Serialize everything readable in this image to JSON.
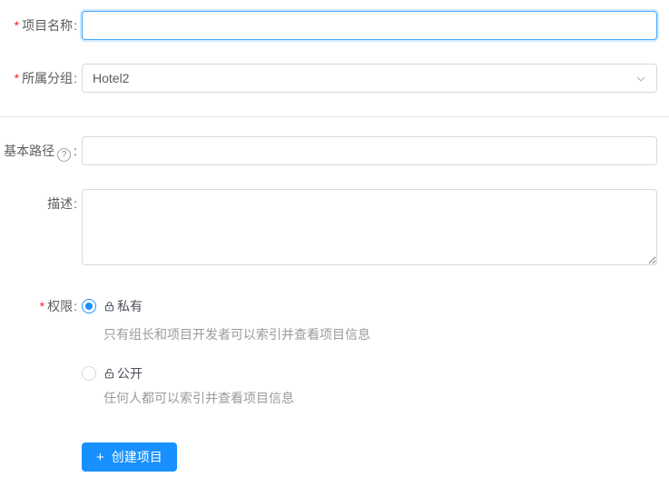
{
  "form": {
    "required_mark": "*",
    "colon": ":",
    "fields": {
      "project_name": {
        "label": "项目名称",
        "required": true,
        "value": "",
        "focused": true
      },
      "group": {
        "label": "所属分组",
        "required": true,
        "value": "Hotel2"
      },
      "base_path": {
        "label": "基本路径",
        "value": "",
        "help_glyph": "?"
      },
      "description": {
        "label": "描述",
        "value": ""
      },
      "permission": {
        "label": "权限",
        "required": true,
        "options": [
          {
            "label": "私有",
            "icon": "lock-closed-icon",
            "selected": true,
            "description": "只有组长和项目开发者可以索引并查看项目信息"
          },
          {
            "label": "公开",
            "icon": "lock-open-icon",
            "selected": false,
            "description": "任何人都可以索引并查看项目信息"
          }
        ]
      }
    },
    "submit": {
      "plus_glyph": "+",
      "label": "创建项目"
    }
  },
  "colors": {
    "primary": "#1890ff",
    "focus_border": "#40a9ff",
    "input_border": "#d9d9d9",
    "divider": "#e8e8e8",
    "required": "#f5222d",
    "label_text": "#5c5c5c",
    "help_text": "#9b9b9b"
  }
}
